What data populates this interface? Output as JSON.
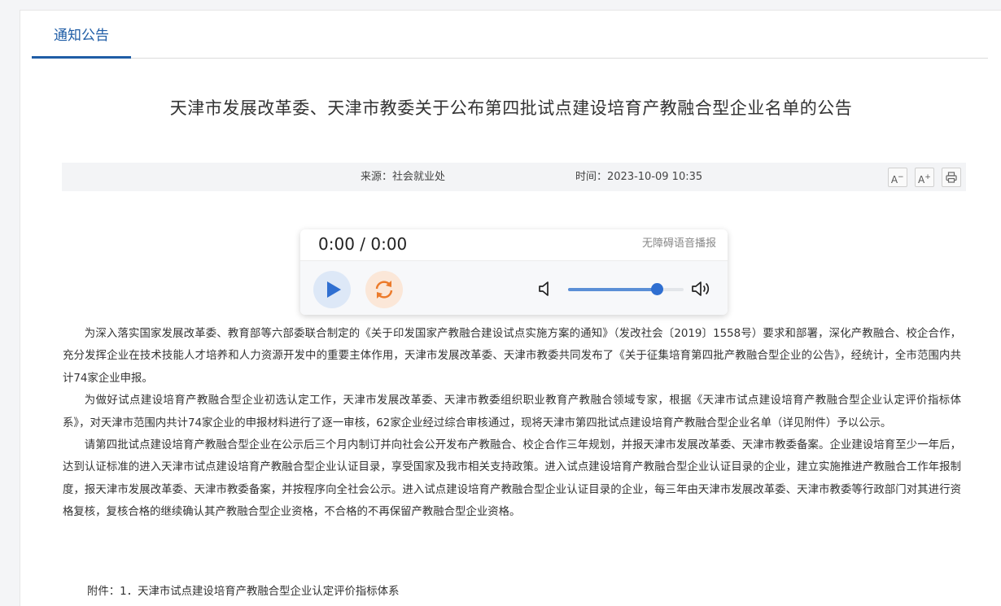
{
  "tab": {
    "label": "通知公告"
  },
  "article": {
    "title": "天津市发展改革委、天津市教委关于公布第四批试点建设培育产教融合型企业名单的公告",
    "source": "来源：社会就业处",
    "time": "时间：2023-10-09 10:35",
    "paragraphs": [
      "为深入落实国家发展改革委、教育部等六部委联合制定的《关于印发国家产教融合建设试点实施方案的通知》（发改社会〔2019〕1558号）要求和部署，深化产教融合、校企合作，充分发挥企业在技术技能人才培养和人力资源开发中的重要主体作用，天津市发展改革委、天津市教委共同发布了《关于征集培育第四批产教融合型企业的公告》，经统计，全市范围内共计74家企业申报。",
      "为做好试点建设培育产教融合型企业初选认定工作，天津市发展改革委、天津市教委组织职业教育产教融合领域专家，根据《天津市试点建设培育产教融合型企业认定评价指标体系》，对天津市范围内共计74家企业的申报材料进行了逐一审核，62家企业经过综合审核通过，现将天津市第四批试点建设培育产教融合型企业名单（详见附件）予以公示。",
      "请第四批试点建设培育产教融合型企业在公示后三个月内制订并向社会公开发布产教融合、校企合作三年规划，并报天津市发展改革委、天津市教委备案。企业建设培育至少一年后，达到认证标准的进入天津市试点建设培育产教融合型企业认证目录，享受国家及我市相关支持政策。进入试点建设培育产教融合型企业认证目录的企业，建立实施推进产教融合工作年报制度，报天津市发展改革委、天津市教委备案，并按程序向全社会公示。进入试点建设培育产教融合型企业认证目录的企业，每三年由天津市发展改革委、天津市教委等行政部门对其进行资格复核，复核合格的继续确认其产教融合型企业资格，不合格的不再保留产教融合型企业资格。"
    ],
    "attachment": "附件：1．天津市试点建设培育产教融合型企业认定评价指标体系"
  },
  "tools": {
    "font_decrease": "A",
    "font_increase": "A",
    "font_decrease_icon": "font-decrease-icon",
    "font_increase_icon": "font-increase-icon",
    "print_icon": "print-icon"
  },
  "player": {
    "time": "0:00 / 0:00",
    "label": "无障碍语音播报",
    "volume": 0.77,
    "play_icon": "play-icon",
    "loop_icon": "loop-icon",
    "colors": {
      "play": "#2f6fd1",
      "loop": "#ec7a2a"
    }
  }
}
